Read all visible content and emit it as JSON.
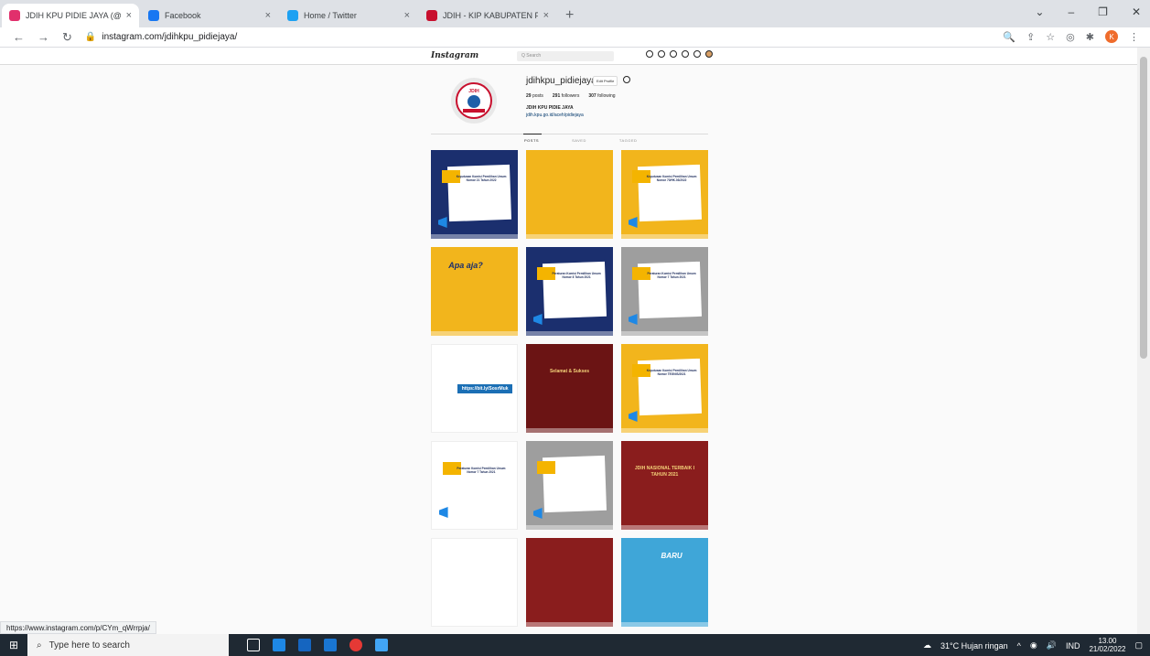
{
  "browser": {
    "tabs": [
      {
        "title": "JDIH KPU PIDIE JAYA (@jdihkpu_",
        "color": "#e1306c"
      },
      {
        "title": "Facebook",
        "color": "#1877f2"
      },
      {
        "title": "Home / Twitter",
        "color": "#1da1f2"
      },
      {
        "title": "JDIH - KIP KABUPATEN PIDIE JAY",
        "color": "#c8102e"
      }
    ],
    "tab_close": "×",
    "new_tab": "+",
    "url": "instagram.com/jdihkpu_pidiejaya/",
    "status_url": "https://www.instagram.com/p/CYm_qWrrpja/"
  },
  "instagram": {
    "logo": "Instagram",
    "search_placeholder": "Q Search",
    "profile": {
      "username": "jdihkpu_pidiejaya",
      "edit_label": "Edit Profile",
      "posts_count": "29",
      "posts_label": "posts",
      "followers_count": "291",
      "followers_label": "followers",
      "following_count": "307",
      "following_label": "following",
      "bio_name": "JDIH KPU PIDIE JAYA",
      "bio_link": "jdih.kpu.go.id/aceh/pidiejaya",
      "pic_label": "JDIH"
    },
    "tabs": [
      "POSTS",
      "SAVED",
      "TAGGED"
    ],
    "posts": [
      {
        "style": "p-navy",
        "caption": "Keputusan Komisi Pemilihan Umum Nomor 21 Tahun 2022"
      },
      {
        "style": "p-yellow",
        "caption": ""
      },
      {
        "style": "p-yellow",
        "caption": "Keputusan Komisi Pemilihan Umum Nomor 70/HK.03/2022"
      },
      {
        "style": "p-yellow",
        "caption": "Apa aja?"
      },
      {
        "style": "p-navy",
        "caption": "Peraturan Komisi Pemilihan Umum Nomor 8 Tahun 2021"
      },
      {
        "style": "p-gray",
        "caption": "Peraturan Komisi Pemilihan Umum Nomor 7 Tahun 2021"
      },
      {
        "style": "p-white",
        "caption": "https://bit.ly/SosrMuk"
      },
      {
        "style": "p-maroon",
        "caption": "Selamat & Sukses"
      },
      {
        "style": "p-yellow",
        "caption": "Keputusan Komisi Pemilihan Umum Nomor TEGNIS/2021"
      },
      {
        "style": "p-white",
        "caption": "Peraturan Komisi Pemilihan Umum Nomor 7 Tahun 2021"
      },
      {
        "style": "p-gray",
        "caption": ""
      },
      {
        "style": "p-red",
        "caption": "JDIH NASIONAL TERBAIK I TAHUN 2021"
      },
      {
        "style": "p-white",
        "caption": ""
      },
      {
        "style": "p-red",
        "caption": ""
      },
      {
        "style": "p-teal",
        "caption": "BARU"
      }
    ]
  },
  "taskbar": {
    "search_placeholder": "Type here to search",
    "weather": "31°C  Hujan ringan",
    "lang": "IND",
    "time": "13.00",
    "date": "21/02/2022"
  }
}
